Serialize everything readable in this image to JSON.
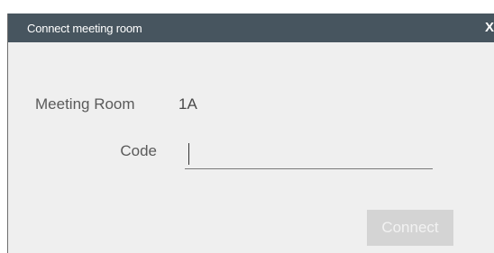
{
  "dialog": {
    "title": "Connect meeting room",
    "close_label": "X"
  },
  "form": {
    "room_label": "Meeting Room",
    "room_value": "1A",
    "code_label": "Code",
    "code_value": "",
    "code_placeholder": ""
  },
  "actions": {
    "connect_label": "Connect",
    "connect_enabled": false
  },
  "colors": {
    "titlebar": "#47555f",
    "dialog_bg": "#efefef",
    "button_disabled_bg": "#d4d4d4"
  }
}
